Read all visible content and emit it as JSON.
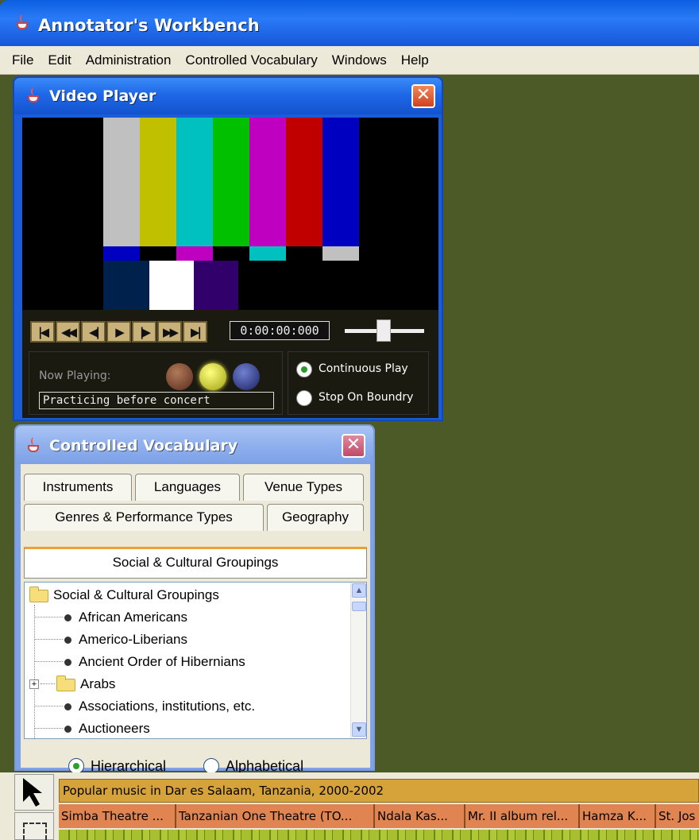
{
  "app": {
    "title": "Annotator's Workbench",
    "menu": [
      "File",
      "Edit",
      "Administration",
      "Controlled Vocabulary",
      "Windows",
      "Help"
    ]
  },
  "video_player": {
    "title": "Video Player",
    "close_glyph": "✕",
    "timecode": "0:00:00:000",
    "now_playing_label": "Now Playing:",
    "now_playing_value": "Practicing before concert",
    "play_modes": [
      {
        "label": "Continuous Play",
        "selected": true
      },
      {
        "label": "Stop On Boundry",
        "selected": false
      }
    ],
    "transport_glyphs": [
      "|◀",
      "◀◀",
      "◀|",
      "▶",
      "|▶",
      "▶▶",
      "▶|"
    ],
    "volume_level": 0.5
  },
  "controlled_vocabulary": {
    "title": "Controlled Vocabulary",
    "close_glyph": "✕",
    "tabs_row1": [
      "Instruments",
      "Languages",
      "Venue Types"
    ],
    "tabs_row2": [
      "Genres & Performance Types",
      "Geography"
    ],
    "active_tab": "Social & Cultural Groupings",
    "tree": {
      "root": "Social & Cultural Groupings",
      "items": [
        {
          "label": "African Americans",
          "kind": "leaf"
        },
        {
          "label": "Americo-Liberians",
          "kind": "leaf"
        },
        {
          "label": "Ancient Order of Hibernians",
          "kind": "leaf"
        },
        {
          "label": "Arabs",
          "kind": "folder"
        },
        {
          "label": "Associations, institutions, etc.",
          "kind": "leaf"
        },
        {
          "label": "Auctioneers",
          "kind": "leaf"
        }
      ]
    },
    "view_modes": [
      {
        "label": "Hierarchical",
        "selected": true
      },
      {
        "label": "Alphabetical",
        "selected": false
      }
    ]
  },
  "timeline": {
    "top_track": "Popular music in Dar es Salaam, Tanzania, 2000-2002",
    "segments": [
      "Simba Theatre ...",
      "Tanzanian One Theatre (TO...",
      "Ndala Kas...",
      "Mr. II album rel...",
      "Hamza K...",
      "St. Jos"
    ]
  },
  "colors": {
    "desktop": "#4c5a28",
    "xp_blue": "#1f68e8",
    "track_gold": "#d6a33a",
    "track_orange": "#e08452",
    "track_green": "#a8c030"
  }
}
